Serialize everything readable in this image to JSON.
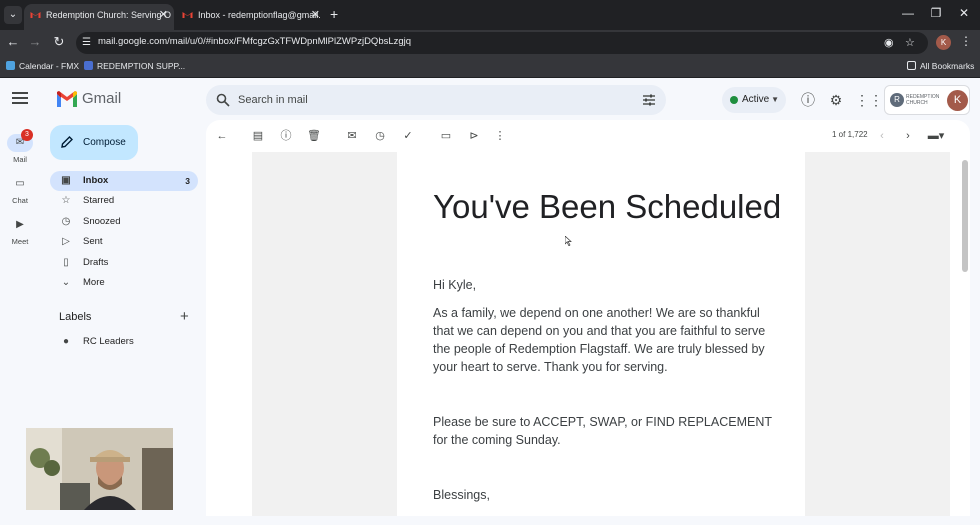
{
  "browser": {
    "tabs": [
      {
        "title": "Redemption Church: Serving O",
        "active": true
      },
      {
        "title": "Inbox - redemptionflag@gmail.",
        "active": false
      }
    ],
    "url": "mail.google.com/mail/u/0/#inbox/FMfcgzGxTFWDpnMlPlZWPzjDQbsLzgjq",
    "profile_initial": "K",
    "bookmarks": [
      {
        "label": "Calendar - FMX"
      },
      {
        "label": "REDEMPTION SUPP..."
      }
    ],
    "all_bookmarks": "All Bookmarks"
  },
  "gmail": {
    "logo": "Gmail",
    "search_placeholder": "Search in mail",
    "status": "Active",
    "org_initial": "R",
    "org_name": "REDEMPTION CHURCH",
    "account_initial": "K",
    "compose": "Compose",
    "rail": [
      {
        "label": "Mail",
        "badge": "3"
      },
      {
        "label": "Chat"
      },
      {
        "label": "Meet"
      }
    ],
    "nav": [
      {
        "label": "Inbox",
        "count": "3"
      },
      {
        "label": "Starred"
      },
      {
        "label": "Snoozed"
      },
      {
        "label": "Sent"
      },
      {
        "label": "Drafts"
      },
      {
        "label": "More"
      }
    ],
    "labels_heading": "Labels",
    "labels": [
      {
        "label": "RC Leaders"
      }
    ],
    "pager": "1 of 1,722"
  },
  "email": {
    "headline": "You've Been Scheduled",
    "greeting": "Hi Kyle,",
    "para1": "As a family, we depend on one another! We are so thankful that we can depend on you and that you are faithful to serve the people of Redemption Flagstaff. We are truly blessed by your heart to serve. Thank you for serving.",
    "para2": "Please be sure to ACCEPT, SWAP, or FIND REPLACEMENT for the coming Sunday.",
    "closing": "Blessings,"
  },
  "colors": {
    "accent": "#0b57d0",
    "compose_bg": "#c2e7ff",
    "selected_nav": "#d3e3fd",
    "active_dot": "#1e8e3e",
    "badge_red": "#d93025"
  }
}
